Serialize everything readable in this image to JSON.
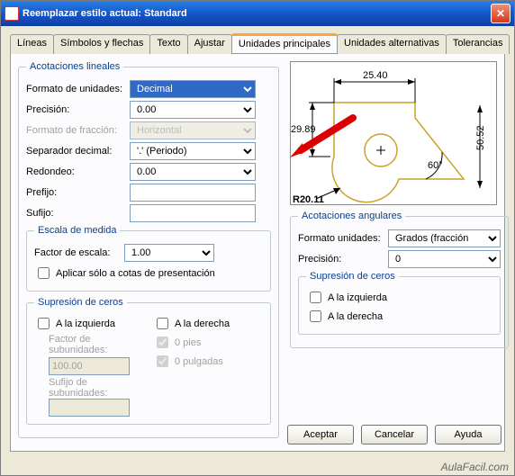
{
  "window": {
    "title": "Reemplazar estilo actual: Standard"
  },
  "tabs": {
    "lineas": "Líneas",
    "simbolos": "Símbolos y flechas",
    "texto": "Texto",
    "ajustar": "Ajustar",
    "unidprinc": "Unidades principales",
    "unidalt": "Unidades alternativas",
    "toler": "Tolerancias"
  },
  "linear": {
    "legend": "Acotaciones lineales",
    "unitfmt_label": "Formato de unidades:",
    "unitfmt_value": "Decimal",
    "precision_label": "Precisión:",
    "precision_value": "0.00",
    "fracfmt_label": "Formato de fracción:",
    "fracfmt_value": "Horizontal",
    "decsep_label": "Separador decimal:",
    "decsep_value": "'.' (Periodo)",
    "round_label": "Redondeo:",
    "round_value": "0.00",
    "prefix_label": "Prefijo:",
    "prefix_value": "",
    "suffix_label": "Sufijo:",
    "suffix_value": ""
  },
  "scale": {
    "legend": "Escala de medida",
    "factor_label": "Factor de escala:",
    "factor_value": "1.00",
    "applyonly_label": "Aplicar sólo a cotas de presentación"
  },
  "zerosup": {
    "legend": "Supresión de ceros",
    "left_label": "A la izquierda",
    "right_label": "A la derecha",
    "subfactor_label": "Factor de subunidades:",
    "subfactor_value": "100.00",
    "subsuffix_label": "Sufijo de subunidades:",
    "subsuffix_value": "",
    "feet_label": "0 pies",
    "inches_label": "0 pulgadas"
  },
  "angular": {
    "legend": "Acotaciones angulares",
    "unitfmt_label": "Formato unidades:",
    "unitfmt_value": "Grados (fracción decimal)",
    "precision_label": "Precisión:",
    "precision_value": "0",
    "zs_legend": "Supresión de ceros",
    "zs_left": "A la izquierda",
    "zs_right": "A la derecha"
  },
  "buttons": {
    "ok": "Aceptar",
    "cancel": "Cancelar",
    "help": "Ayuda"
  },
  "preview": {
    "top": "25.40",
    "left": "29.89",
    "right": "50.52",
    "angle": "60°",
    "radius": "R20.11"
  },
  "watermark": "AulaFacil.com"
}
